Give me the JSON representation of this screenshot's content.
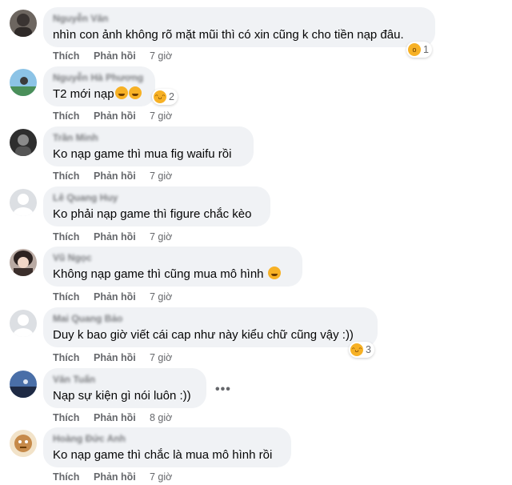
{
  "comments": [
    {
      "name": "Nguyễn Văn",
      "text": "nhìn con ảnh không rõ mặt mũi thì có xin cũng k cho tiền nạp đâu.",
      "like": "Thích",
      "reply": "Phản hồi",
      "time": "7 giờ",
      "reactions": "1",
      "reaction_icon": "wow-face"
    },
    {
      "name": "Nguyễn Hà Phương",
      "text": "T2 mới nạp",
      "like": "Thích",
      "reply": "Phản hồi",
      "time": "7 giờ",
      "reactions": "2",
      "reaction_icon": "haha-face"
    },
    {
      "name": "Trần Minh",
      "text": "Ko nạp game thì mua fig waifu rồi",
      "like": "Thích",
      "reply": "Phản hồi",
      "time": "7 giờ"
    },
    {
      "name": "Lê Quang Huy",
      "text": "Ko phải nạp game thì figure chắc kèo",
      "like": "Thích",
      "reply": "Phản hồi",
      "time": "7 giờ"
    },
    {
      "name": "Vũ Ngọc",
      "text": "Không nạp game thì cũng mua mô hình",
      "like": "Thích",
      "reply": "Phản hồi",
      "time": "7 giờ"
    },
    {
      "name": "Mai Quang Bảo",
      "text": "Duy k bao giờ viết cái cap như này kiểu chữ cũng vậy :))",
      "like": "Thích",
      "reply": "Phản hồi",
      "time": "7 giờ",
      "reactions": "3",
      "reaction_icon": "haha-face"
    },
    {
      "name": "Văn Tuấn",
      "text": "Nạp sự kiện gì nói luôn :))",
      "like": "Thích",
      "reply": "Phản hồi",
      "time": "8 giờ"
    },
    {
      "name": "Hoàng Đức Anh",
      "text": "Ko nạp game thì chắc là mua mô hình rồi",
      "like": "Thích",
      "reply": "Phản hồi",
      "time": "7 giờ"
    }
  ],
  "more_options": "•••",
  "colors": {
    "bubble": "#f0f2f5",
    "meta": "#65676b",
    "text": "#050505",
    "emoji": "#f7b125"
  }
}
